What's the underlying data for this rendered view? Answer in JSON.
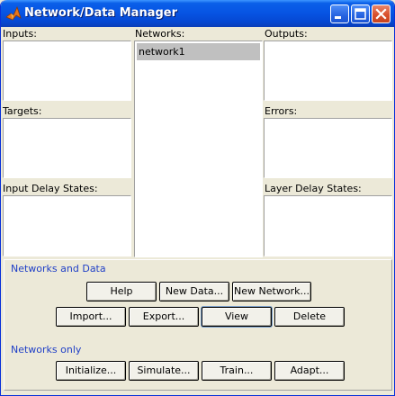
{
  "window": {
    "title": "Network/Data Manager"
  },
  "labels": {
    "inputs": "Inputs:",
    "networks": "Networks:",
    "outputs": "Outputs:",
    "targets": "Targets:",
    "errors": "Errors:",
    "input_delay_states": "Input Delay States:",
    "layer_delay_states": "Layer Delay States:"
  },
  "networks_list": [
    "network1"
  ],
  "groups": {
    "networks_and_data": "Networks and Data",
    "networks_only": "Networks only"
  },
  "buttons": {
    "help": "Help",
    "new_data": "New Data...",
    "new_network": "New Network...",
    "import": "Import...",
    "export": "Export...",
    "view": "View",
    "delete": "Delete",
    "initialize": "Initialize...",
    "simulate": "Simulate...",
    "train": "Train...",
    "adapt": "Adapt..."
  },
  "colors": {
    "titlebar": "#0755e4",
    "face": "#ece9d8",
    "group_title": "#1f3fc7",
    "selection": "#c0c0c0"
  },
  "icons": {
    "app": "matlab-membrane-icon",
    "minimize": "minimize-icon",
    "maximize": "maximize-icon",
    "close": "close-icon"
  }
}
